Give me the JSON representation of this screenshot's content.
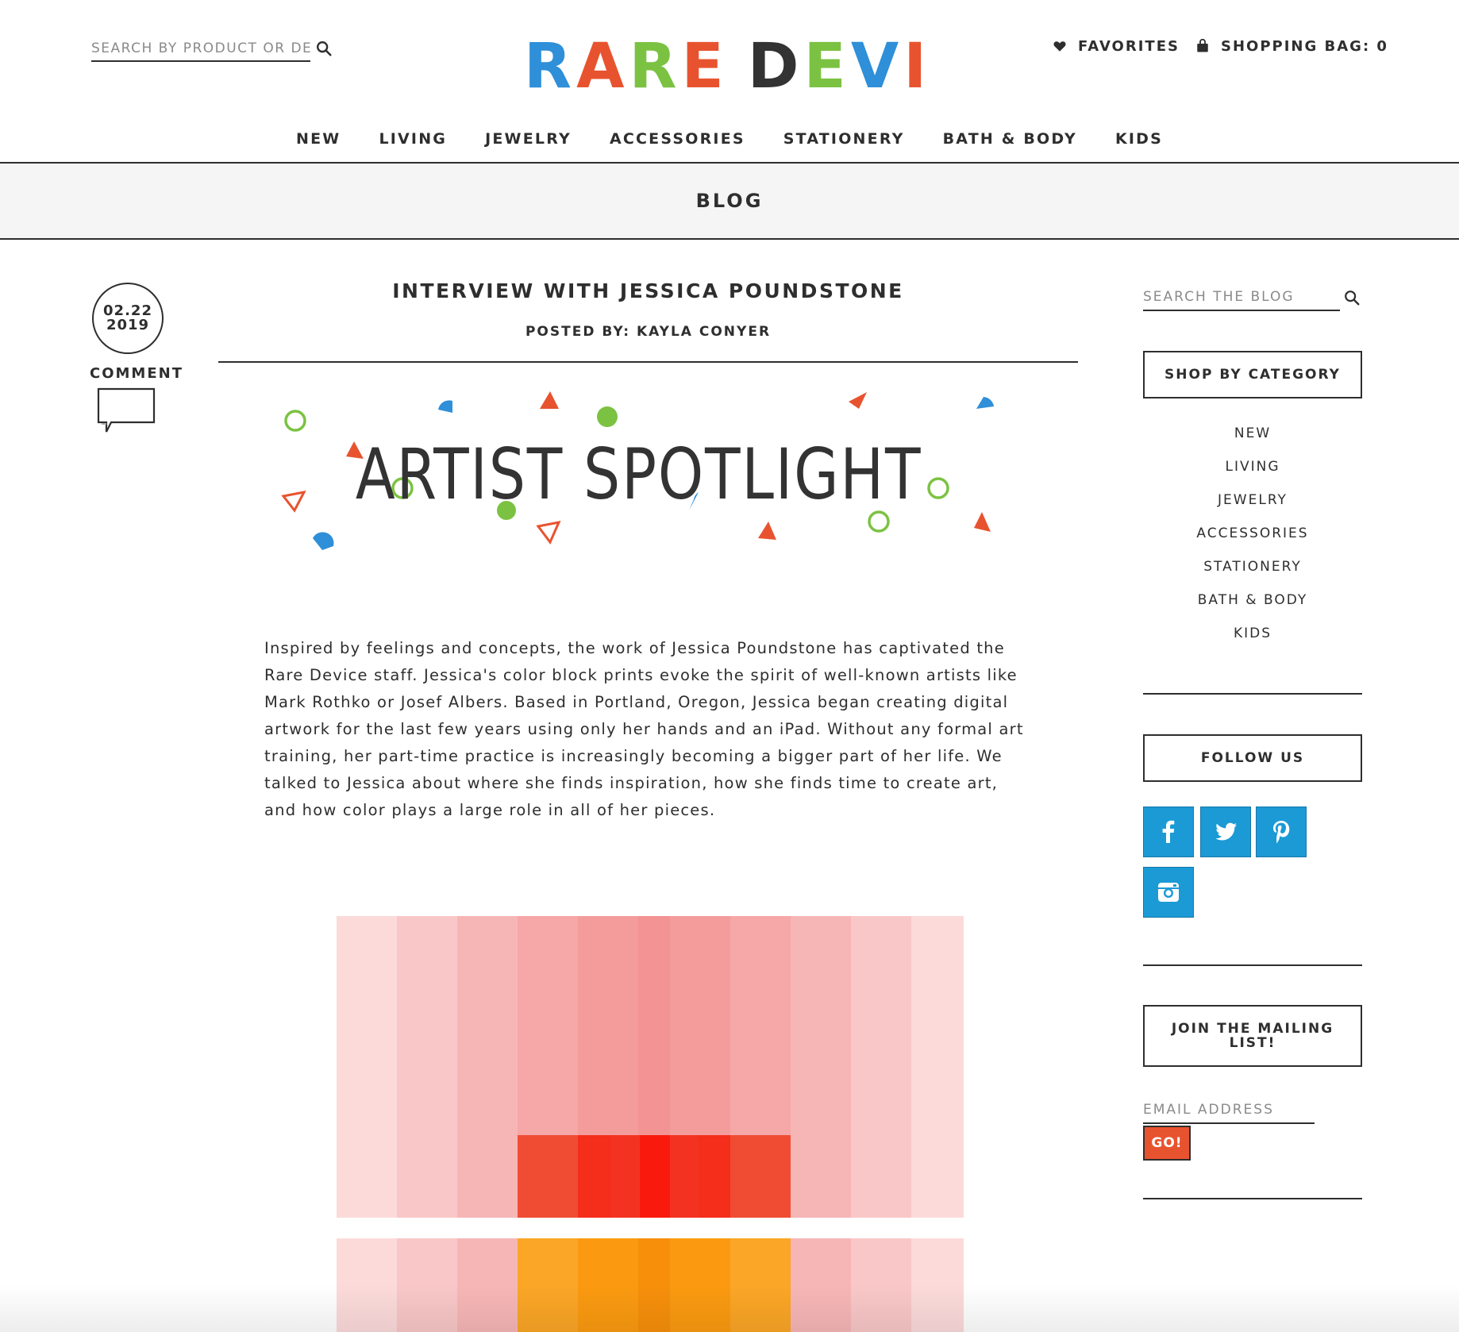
{
  "header": {
    "search_placeholder": "SEARCH BY PRODUCT OR DESIGNER",
    "logo_text": "RARE DEVICE",
    "favorites_label": "FAVORITES",
    "shopping_bag_label": "SHOPPING BAG: 0"
  },
  "nav": {
    "items": [
      "NEW",
      "LIVING",
      "JEWELRY",
      "ACCESSORIES",
      "STATIONERY",
      "BATH & BODY",
      "KIDS"
    ]
  },
  "section": {
    "title": "BLOG"
  },
  "post": {
    "date_month_day": "02.22",
    "date_year": "2019",
    "comment_label": "COMMENT",
    "title": "INTERVIEW WITH JESSICA POUNDSTONE",
    "posted_by": "POSTED BY: KAYLA CONYER",
    "banner_text": "ARTIST SPOTLIGHT",
    "body": "Inspired by feelings and concepts, the work of Jessica Poundstone has captivated the Rare Device staff. Jessica's color block prints evoke the spirit of well-known artists like Mark Rothko or Josef Albers. Based in Portland, Oregon, Jessica began creating digital artwork for the last few years using only her hands and an iPad. Without any formal art training, her part-time practice is increasingly becoming a bigger part of her life. We talked to Jessica about where she finds inspiration, how she finds time to create art, and how color plays a large role in all of her pieces."
  },
  "sidebar": {
    "search_placeholder": "SEARCH THE BLOG",
    "shop_by_category": "SHOP BY CATEGORY",
    "categories": [
      "NEW",
      "LIVING",
      "JEWELRY",
      "ACCESSORIES",
      "STATIONERY",
      "BATH & BODY",
      "KIDS"
    ],
    "follow_us": "FOLLOW US",
    "social_icons": [
      "facebook-icon",
      "twitter-icon",
      "pinterest-icon",
      "instagram-icon"
    ],
    "mailing_list": "JOIN THE MAILING LIST!",
    "email_placeholder": "EMAIL ADDRESS",
    "go_label": "GO!"
  },
  "colors": {
    "text": "#2e2e2e",
    "social_blue": "#1b9ad6",
    "go_orange": "#e8532f",
    "confetti_green": "#7cc242",
    "confetti_orange": "#e8532f",
    "confetti_blue": "#2f8fd8"
  }
}
